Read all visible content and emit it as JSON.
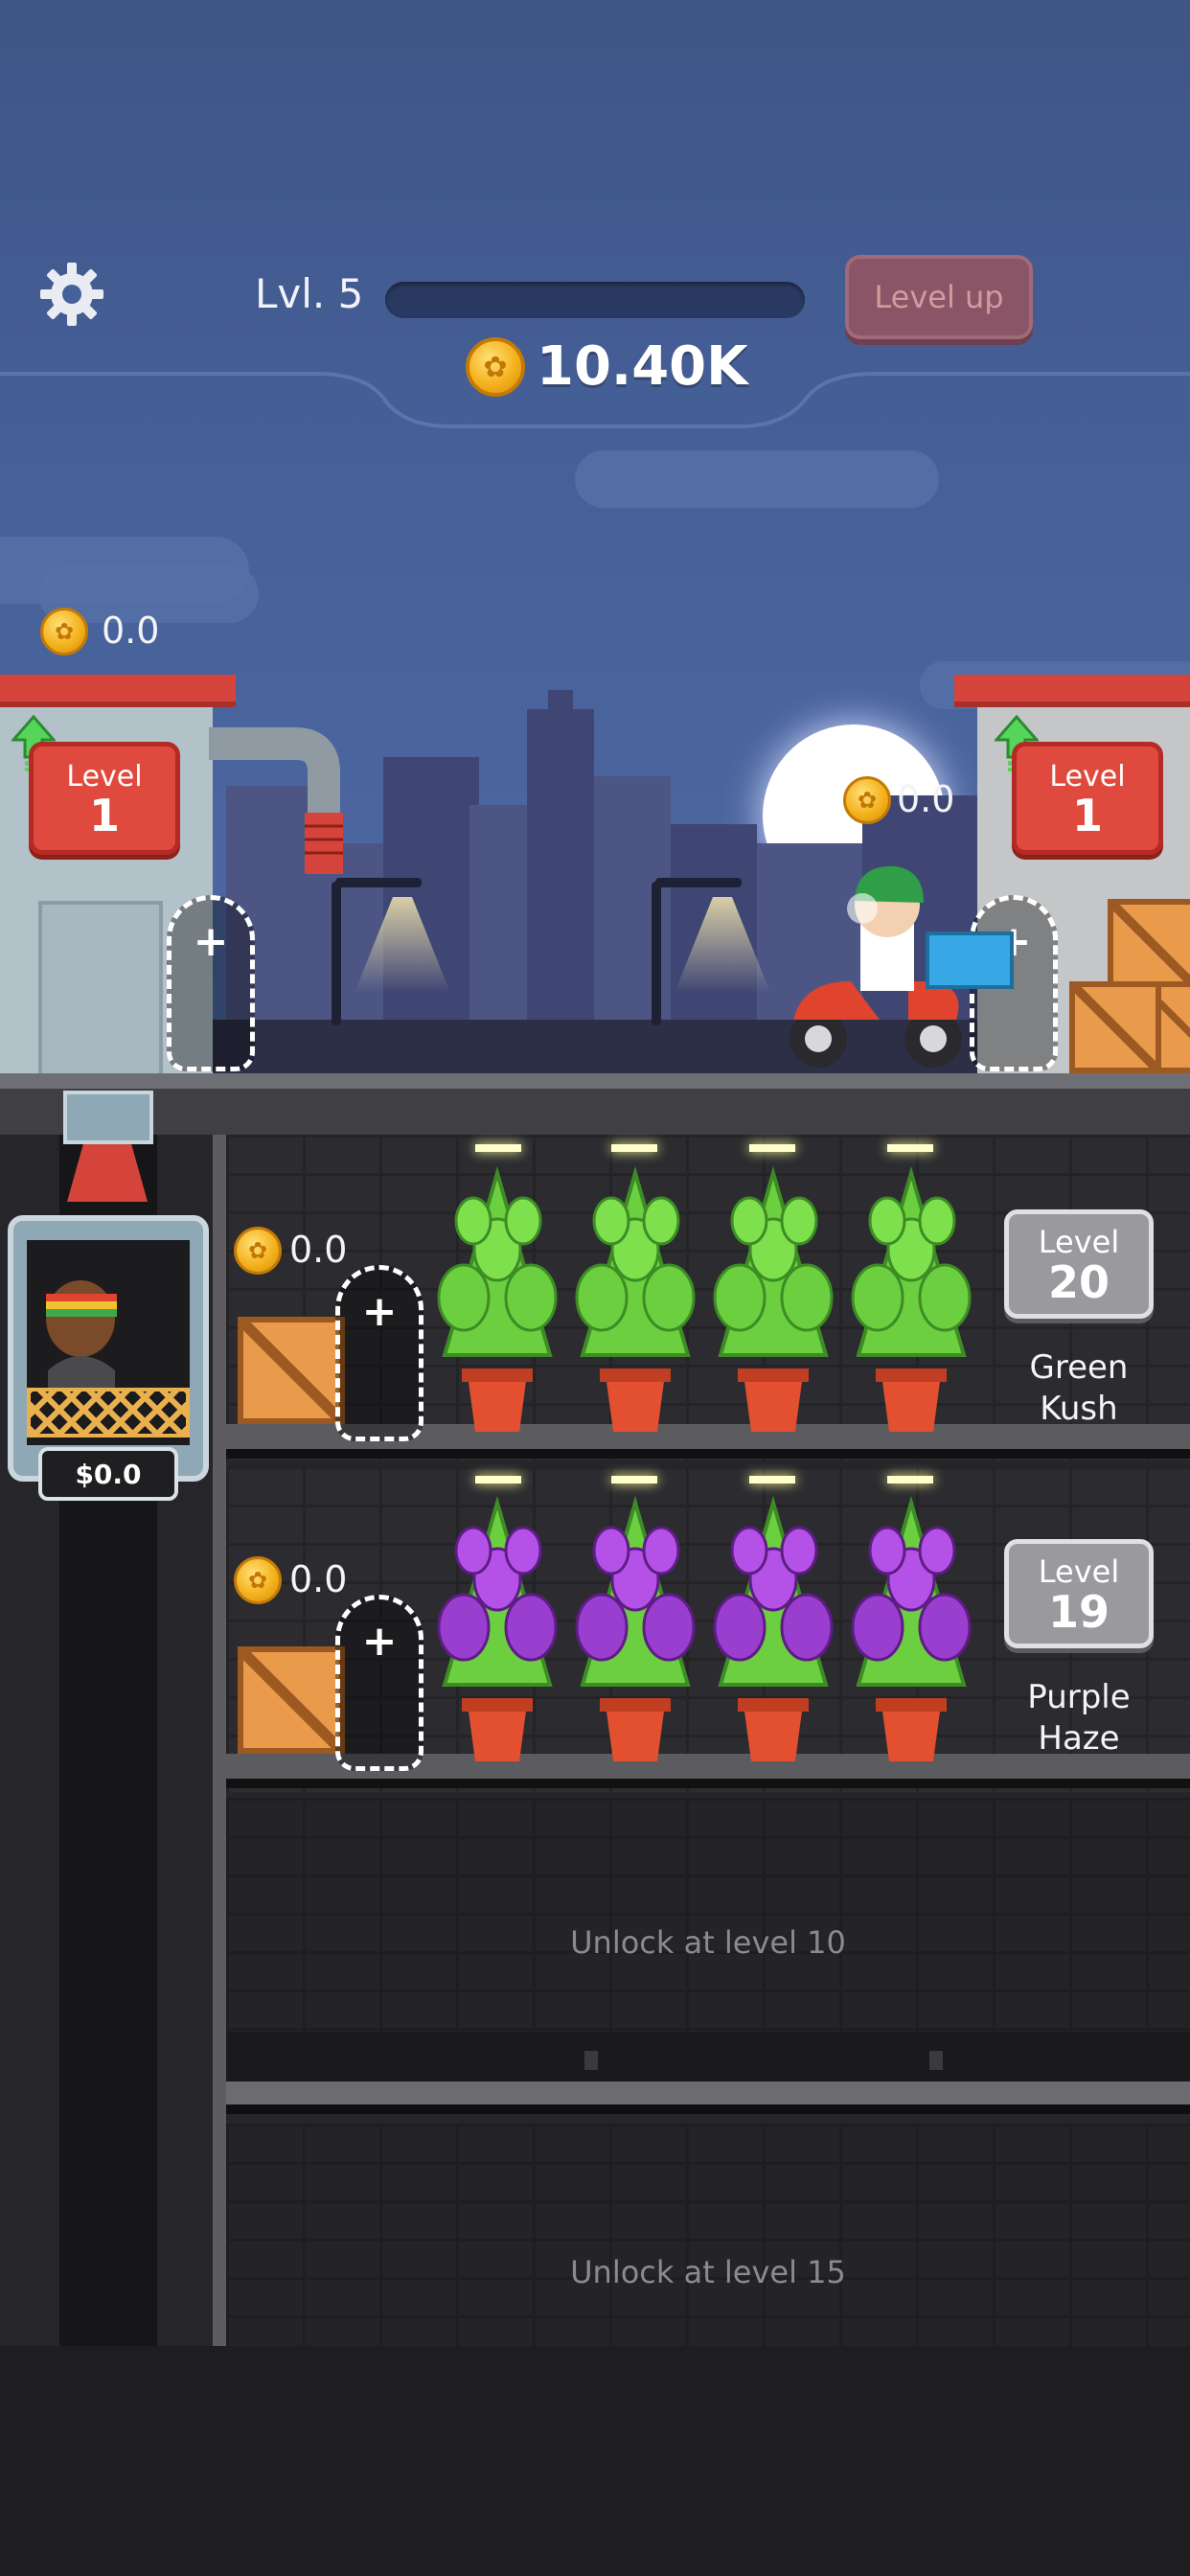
{
  "hud": {
    "level_text": "Lvl. 5",
    "xp_progress": 0.0,
    "level_up_label": "Level up",
    "total_coins": "10.40K"
  },
  "street": {
    "warehouse_coins": "0.0",
    "warehouse_level_label": "Level",
    "warehouse_level": "1",
    "delivery_coins": "0.0",
    "delivery_level_label": "Level",
    "delivery_level": "1"
  },
  "elevator": {
    "cash": "$0.0"
  },
  "floors": [
    {
      "coins": "0.0",
      "level_label": "Level",
      "level": "20",
      "strain_line1": "Green",
      "strain_line2": "Kush",
      "leaf_color": "#6ccf3f"
    },
    {
      "coins": "0.0",
      "level_label": "Level",
      "level": "19",
      "strain_line1": "Purple",
      "strain_line2": "Haze",
      "leaf_color": "#9a3ed0"
    }
  ],
  "locked_floors": [
    {
      "text": "Unlock at level 10"
    },
    {
      "text": "Unlock at level 15"
    }
  ],
  "icons": {
    "settings": "gear-icon",
    "coin": "coin-icon",
    "upgrade": "up-arrow-icon",
    "add_worker": "plus-icon"
  },
  "colors": {
    "sky": "#46609a",
    "level_up_disabled": "#8a5566",
    "upgrade_card": "#e04a3e",
    "coin": "#f4b21e"
  }
}
